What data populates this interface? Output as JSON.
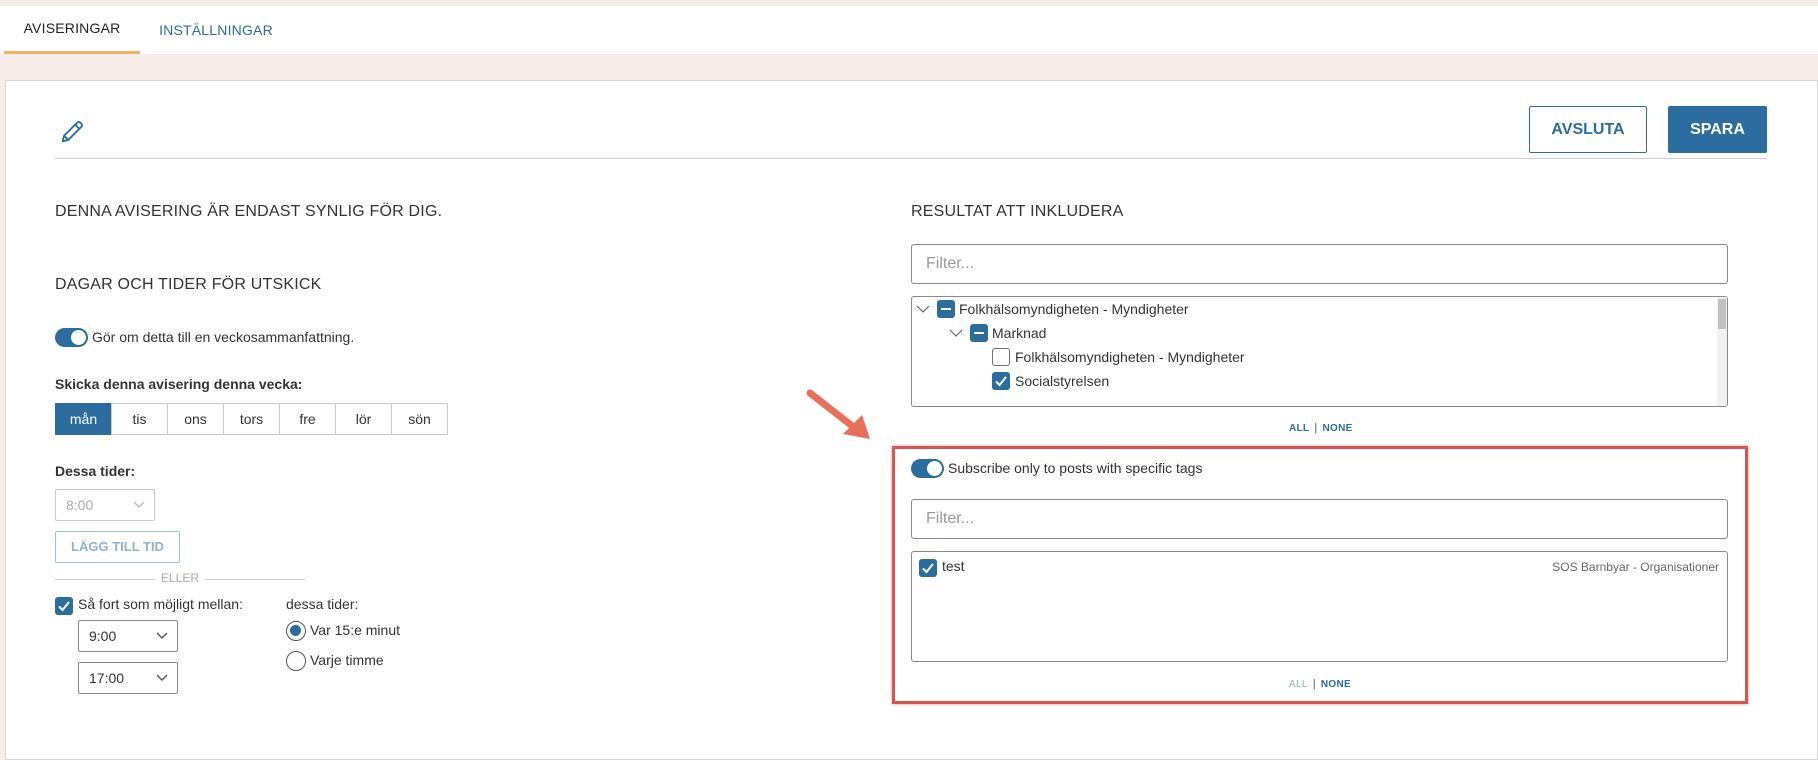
{
  "tabs": [
    {
      "label": "AVISERINGAR",
      "active": true
    },
    {
      "label": "INSTÄLLNINGAR",
      "active": false
    }
  ],
  "toolbar": {
    "avsluta_label": "AVSLUTA",
    "spara_label": "SPARA",
    "edit_icon": "pencil-icon"
  },
  "left": {
    "notice": "DENNA AVISERING ÄR ENDAST SYNLIG FÖR DIG.",
    "days_heading": "DAGAR OCH TIDER FÖR UTSKICK",
    "weekly_toggle_label": "Gör om detta till en veckosammanfattning.",
    "weekly_toggle_on": true,
    "send_label": "Skicka denna avisering denna vecka:",
    "days": [
      {
        "label": "mån",
        "selected": true
      },
      {
        "label": "tis",
        "selected": false
      },
      {
        "label": "ons",
        "selected": false
      },
      {
        "label": "tors",
        "selected": false
      },
      {
        "label": "fre",
        "selected": false
      },
      {
        "label": "lör",
        "selected": false
      },
      {
        "label": "sön",
        "selected": false
      }
    ],
    "times_label": "Dessa tider:",
    "time_value": "8:00",
    "add_time_label": "LÄGG TILL TID",
    "or_label": "ELLER",
    "asap_label": "Så fort som möjligt mellan:",
    "asap_checked": true,
    "from_value": "9:00",
    "to_value": "17:00",
    "these_times_label": "dessa tider:",
    "radio_options": [
      {
        "label": "Var 15:e minut",
        "selected": true
      },
      {
        "label": "Varje timme",
        "selected": false
      }
    ]
  },
  "right": {
    "heading": "RESULTAT ATT INKLUDERA",
    "filter_placeholder": "Filter...",
    "tree": [
      {
        "label": "Folkhälsomyndigheten - Myndigheter",
        "state": "partial",
        "expanded": true
      },
      {
        "label": "Marknad",
        "state": "partial",
        "expanded": true
      },
      {
        "label": "Folkhälsomyndigheten - Myndigheter",
        "state": "unchecked"
      },
      {
        "label": "Socialstyrelsen",
        "state": "checked"
      }
    ],
    "all_label": "ALL",
    "none_label": "NONE",
    "tags_toggle_label": "Subscribe only to posts with specific tags",
    "tags_toggle_on": true,
    "tags_filter_placeholder": "Filter...",
    "tags": [
      {
        "label": "test",
        "org": "SOS Barnbyar - Organisationer",
        "checked": true
      }
    ]
  },
  "colors": {
    "accent": "#2a6d9e",
    "tab_underline": "#f2b266",
    "highlight": "#d9534f"
  }
}
